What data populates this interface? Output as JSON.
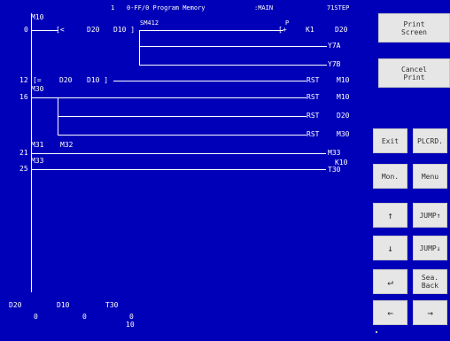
{
  "header": {
    "page_no": "1",
    "mode": "0-FF/0 Program Memory",
    "program": ":MAIN",
    "steps": "71STEP"
  },
  "ladder": {
    "rung_0": {
      "step": "0",
      "contact_m10": "M10",
      "compare_op": "[<",
      "compare_a": "D20",
      "compare_b": "D10 ]",
      "contact_sm412": "SM412",
      "p_label": "P",
      "inc_op": "[+",
      "inc_k": "K1",
      "inc_dest": "D20",
      "coil_y7a": "Y7A",
      "coil_y7b": "Y7B"
    },
    "rung_12": {
      "step": "12",
      "compare_op": "[=",
      "compare_a": "D20",
      "compare_b": "D10 ]",
      "rst": "RST",
      "target": "M10"
    },
    "rung_16": {
      "step": "16",
      "contact_m30": "M30",
      "rst1": "RST",
      "target1": "M10",
      "rst2": "RST",
      "target2": "D20",
      "rst3": "RST",
      "target3": "M30"
    },
    "rung_21": {
      "step": "21",
      "contact_m31": "M31",
      "contact_m32": "M32",
      "coil": "M33"
    },
    "rung_25": {
      "step": "25",
      "contact_m33": "M33",
      "coil_k": "K10",
      "coil": "T30"
    }
  },
  "monitor": {
    "items": [
      {
        "name": "D20",
        "value": "0"
      },
      {
        "name": "D10",
        "value": "0"
      },
      {
        "name": "T30",
        "value": "0",
        "setting": "10"
      }
    ]
  },
  "panel": {
    "print_screen": "Print\nScreen",
    "cancel_print": "Cancel\nPrint",
    "exit": "Exit",
    "plcrd": "PLCRD.",
    "mon": "Mon.",
    "menu": "Menu",
    "up": "↑",
    "jump_up": "JUMP↑",
    "down": "↓",
    "jump_down": "JUMP↓",
    "enter": "↵",
    "sea_back": "Sea.\nBack",
    "left": "←",
    "right": "→"
  },
  "colors": {
    "background": "#0000b8",
    "ladder_lines": "#ffffff",
    "button_face": "#e6e6e6",
    "button_text": "#303030"
  }
}
